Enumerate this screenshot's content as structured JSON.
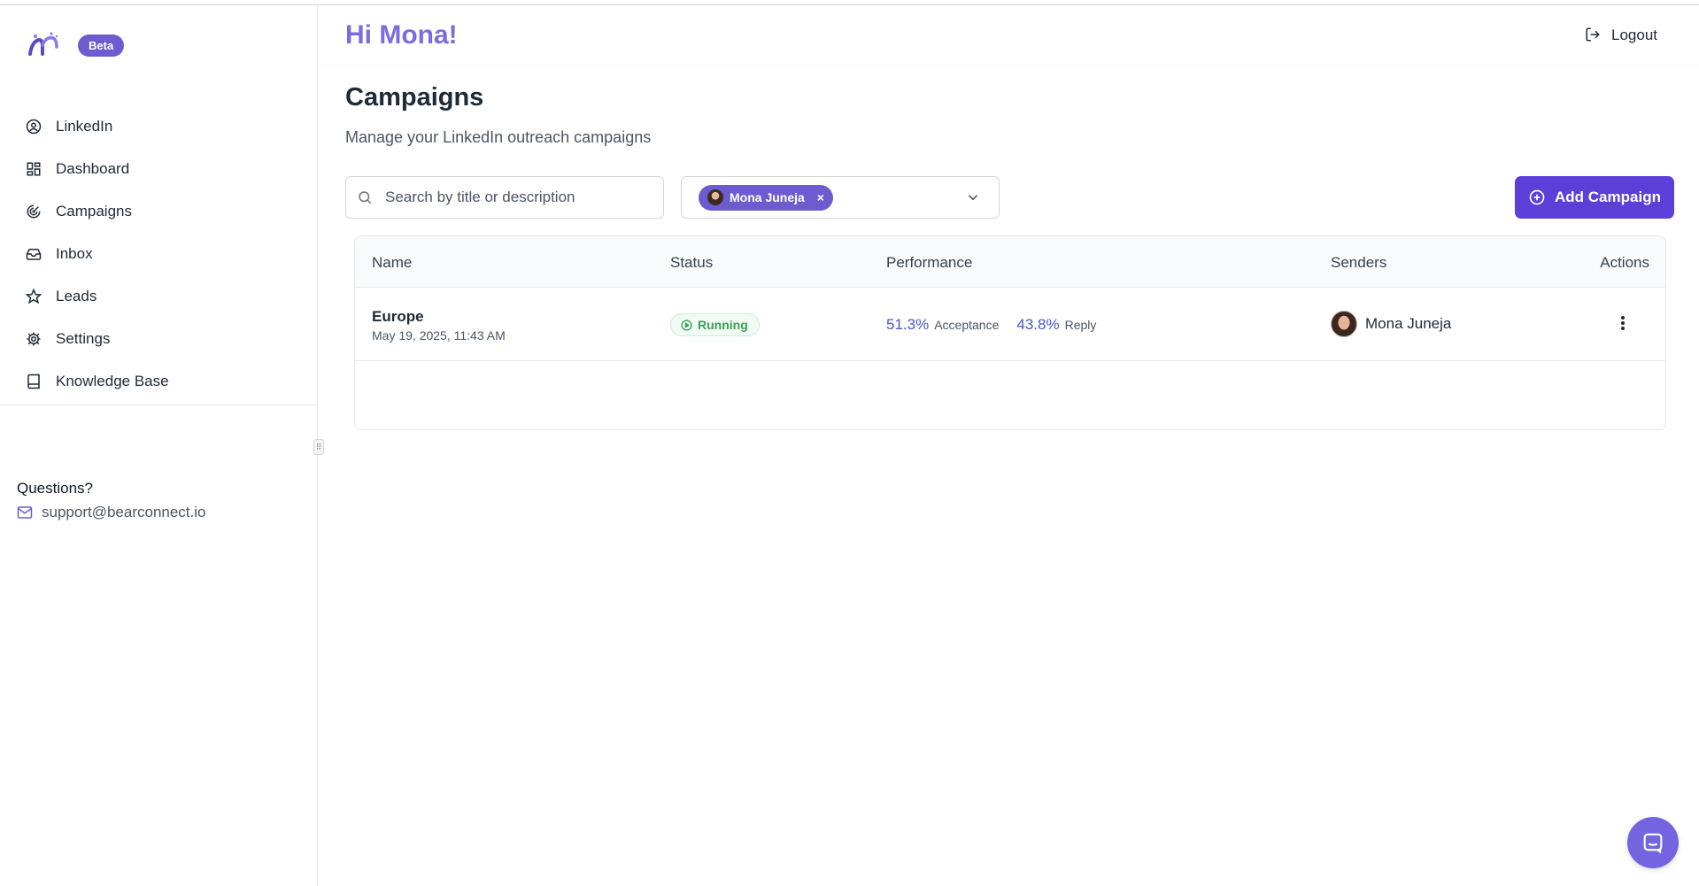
{
  "app": {
    "beta_label": "Beta",
    "greeting": "Hi Mona!",
    "logout_label": "Logout",
    "accent_color": "#6d5bd0"
  },
  "sidebar": {
    "items": [
      {
        "label": "LinkedIn",
        "icon": "user-circle-icon"
      },
      {
        "label": "Dashboard",
        "icon": "grid-icon"
      },
      {
        "label": "Campaigns",
        "icon": "target-icon"
      },
      {
        "label": "Inbox",
        "icon": "inbox-icon"
      },
      {
        "label": "Leads",
        "icon": "star-icon"
      },
      {
        "label": "Settings",
        "icon": "gear-icon"
      },
      {
        "label": "Knowledge Base",
        "icon": "book-icon"
      }
    ],
    "questions_label": "Questions?",
    "support_email": "support@bearconnect.io"
  },
  "main": {
    "title": "Campaigns",
    "subtitle": "Manage your LinkedIn outreach campaigns",
    "search": {
      "placeholder": "Search by title or description",
      "value": ""
    },
    "sender_filter": {
      "selected": "Mona Juneja",
      "remove_label": "×"
    },
    "add_button_label": "Add Campaign"
  },
  "table": {
    "columns": [
      "Name",
      "Status",
      "Performance",
      "Senders",
      "Actions"
    ],
    "rows": [
      {
        "name": "Europe",
        "date": "May 19, 2025, 11:43 AM",
        "status": "Running",
        "acceptance_pct": "51.3%",
        "acceptance_label": "Acceptance",
        "reply_pct": "43.8%",
        "reply_label": "Reply",
        "sender": "Mona Juneja"
      }
    ]
  },
  "colors": {
    "status_running": "#3f9c5b",
    "performance": "#4a56c8",
    "add_button": "#5b3fd8"
  }
}
